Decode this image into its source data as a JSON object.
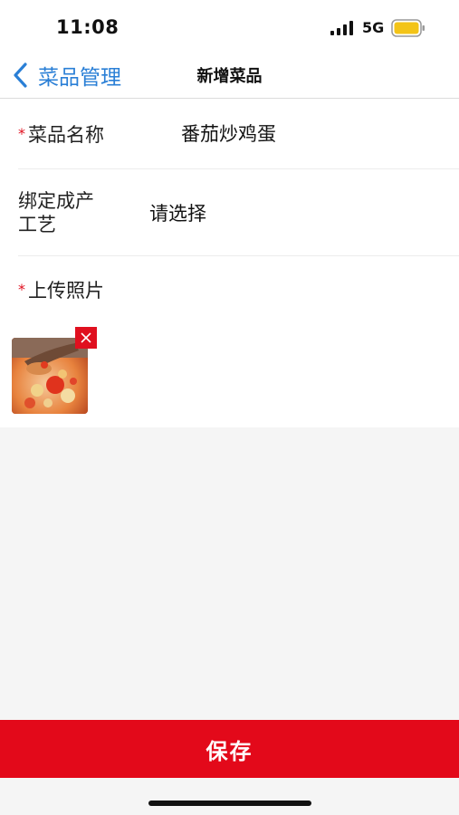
{
  "status_bar": {
    "time": "11:08",
    "network": "5G",
    "signal_icon": "signal-bars-icon",
    "battery_icon": "battery-icon",
    "battery_color": "#f3c418"
  },
  "nav": {
    "back_icon": "chevron-left-icon",
    "back_label": "菜品管理",
    "title": "新增菜品",
    "accent_color": "#2a7fd6"
  },
  "form": {
    "dish_name": {
      "required_mark": "*",
      "label": "菜品名称",
      "value": "番茄炒鸡蛋"
    },
    "process": {
      "label_line1": "绑定成产",
      "label_line2": "工艺",
      "placeholder": "请选择"
    },
    "photo": {
      "required_mark": "*",
      "label": "上传照片",
      "delete_icon": "close-icon"
    }
  },
  "actions": {
    "save_label": "保存",
    "save_color": "#e3091a"
  }
}
